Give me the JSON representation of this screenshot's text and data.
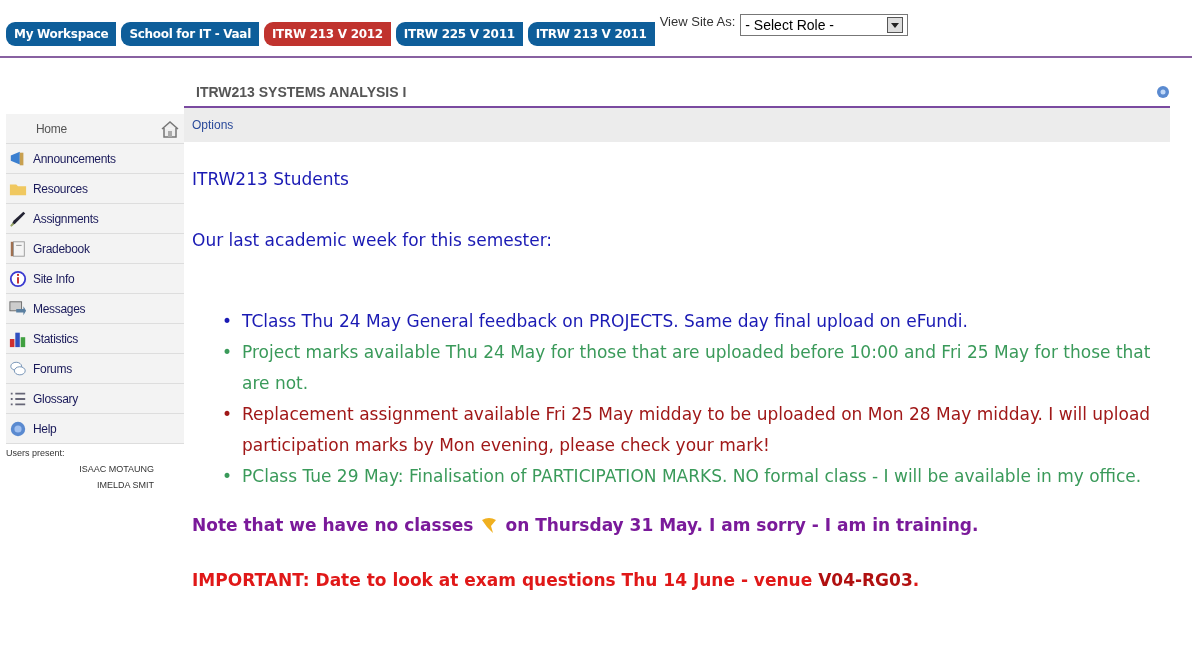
{
  "tabs": [
    {
      "label": "My Workspace",
      "selected": false
    },
    {
      "label": "School for IT - Vaal",
      "selected": false
    },
    {
      "label": "ITRW 213 V 2012",
      "selected": true
    },
    {
      "label": "ITRW 225 V 2011",
      "selected": false
    },
    {
      "label": "ITRW 213 V 2011",
      "selected": false
    }
  ],
  "view_site_as": {
    "label": "View Site As:",
    "value": "- Select Role -"
  },
  "sidebar": {
    "items": [
      {
        "label": "Home",
        "kind": "home"
      },
      {
        "label": "Announcements",
        "kind": "announcements"
      },
      {
        "label": "Resources",
        "kind": "resources"
      },
      {
        "label": "Assignments",
        "kind": "assignments"
      },
      {
        "label": "Gradebook",
        "kind": "gradebook"
      },
      {
        "label": "Site Info",
        "kind": "info"
      },
      {
        "label": "Messages",
        "kind": "messages"
      },
      {
        "label": "Statistics",
        "kind": "statistics"
      },
      {
        "label": "Forums",
        "kind": "forums"
      },
      {
        "label": "Glossary",
        "kind": "glossary"
      },
      {
        "label": "Help",
        "kind": "help"
      }
    ],
    "users_label": "Users present:",
    "users": [
      "ISAAC MOTAUNG",
      "IMELDA SMIT"
    ]
  },
  "page": {
    "title": "ITRW213 SYSTEMS ANALYSIS I",
    "options": "Options",
    "greeting": "ITRW213 Students",
    "intro": "Our last academic week for this semester:",
    "bullets": [
      {
        "text": "TClass Thu 24 May General feedback on PROJECTS. Same day final upload on eFundi.",
        "color": "#1a1ab4",
        "marker": "•"
      },
      {
        "text": "Project marks available Thu 24 May for those that are uploaded before 10:00 and Fri 25 May for those that are not.",
        "color": "#3a9a5a",
        "marker": "•"
      },
      {
        "text": "Replacement assignment available Fri 25 May midday to be uploaded on Mon 28 May midday. I will upload participation marks by Mon evening, please check your mark!",
        "color": "#a01818",
        "marker": "•"
      },
      {
        "text": "PClass Tue 29 May: Finalisation of PARTICIPATION MARKS. NO formal class - I will be available in my office.",
        "color": "#3a9a5a",
        "marker": "•"
      }
    ],
    "note": {
      "before": "Note that we have no classes",
      "after": "on Thursday 31 May. I am sorry - I am in training."
    },
    "important": "IMPORTANT: Date to look at exam questions Thu 14 June - venue **V04-RG03**."
  }
}
